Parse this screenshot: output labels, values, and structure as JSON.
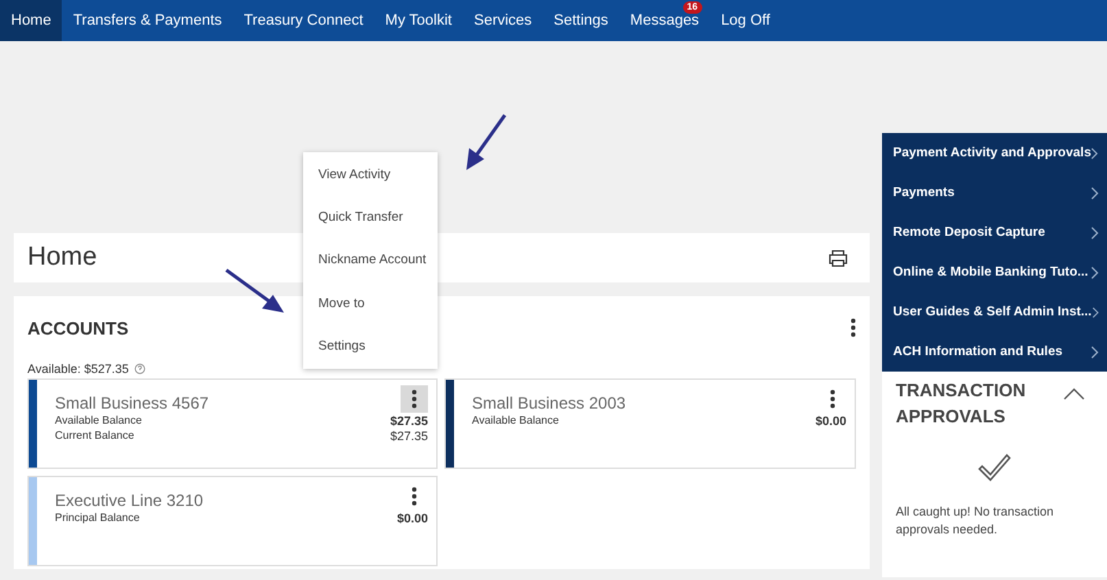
{
  "nav": {
    "items": [
      {
        "label": "Home",
        "selected": true
      },
      {
        "label": "Transfers & Payments",
        "selected": false
      },
      {
        "label": "Treasury Connect",
        "selected": false
      },
      {
        "label": "My Toolkit",
        "selected": false
      },
      {
        "label": "Services",
        "selected": false
      },
      {
        "label": "Settings",
        "selected": false
      },
      {
        "label": "Messages",
        "selected": false,
        "badge": "16"
      },
      {
        "label": "Log Off",
        "selected": false
      }
    ]
  },
  "page_title": "Home",
  "accounts": {
    "title": "ACCOUNTS",
    "available": "Available: $527.35",
    "cards": [
      {
        "name": "Small Business 4567",
        "color": "#0d4a93",
        "menu_open": true,
        "rows": [
          {
            "label": "Available Balance",
            "value": "$27.35",
            "bold": true
          },
          {
            "label": "Current Balance",
            "value": "$27.35",
            "bold": false
          }
        ]
      },
      {
        "name": "Small Business 2003",
        "color": "#0d2f5e",
        "menu_open": false,
        "rows": [
          {
            "label": "Available Balance",
            "value": "$0.00",
            "bold": true
          }
        ]
      },
      {
        "name": "Executive Line 3210",
        "color": "#a7c8f0",
        "menu_open": false,
        "rows": [
          {
            "label": "Principal Balance",
            "value": "$0.00",
            "bold": true
          }
        ]
      }
    ]
  },
  "context_menu": {
    "items": [
      "View Activity",
      "Quick Transfer",
      "Nickname Account",
      "Move to",
      "Settings"
    ]
  },
  "quick_links": [
    "Payment Activity and Approvals",
    "Payments",
    "Remote Deposit Capture",
    "Online & Mobile Banking Tuto...",
    "User Guides & Self Admin Inst...",
    "ACH Information and Rules"
  ],
  "approvals": {
    "title": "TRANSACTION APPROVALS",
    "expanded": true,
    "message": "All caught up! No transaction approvals needed."
  }
}
